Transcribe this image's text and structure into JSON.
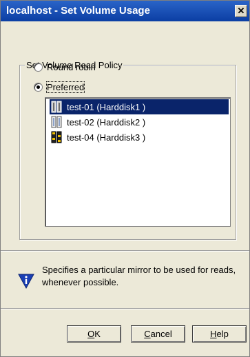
{
  "window": {
    "title": "localhost - Set Volume Usage",
    "close_glyph": "✕"
  },
  "group": {
    "label": "Set Volume Read Policy"
  },
  "radios": [
    {
      "label": "Round robin",
      "checked": false
    },
    {
      "label": "Preferred",
      "checked": true
    }
  ],
  "list": {
    "items": [
      {
        "label": "test-01 (Harddisk1 )",
        "selected": true,
        "icon": "disk-icon"
      },
      {
        "label": "test-02 (Harddisk2 )",
        "selected": false,
        "icon": "disk-icon"
      },
      {
        "label": "test-04 (Harddisk3 )",
        "selected": false,
        "icon": "disk-warning-icon"
      }
    ]
  },
  "info": {
    "text": "Specifies a particular mirror to be used for reads, whenever possible.",
    "icon": "info-shield-icon"
  },
  "buttons": {
    "ok": {
      "label": "OK",
      "accel": "O",
      "rest": "K"
    },
    "cancel": {
      "label": "Cancel",
      "accel": "C",
      "rest": "ancel"
    },
    "help": {
      "label": "Help",
      "accel": "H",
      "rest": "elp"
    }
  },
  "colors": {
    "title_bar": "#0b3ea3",
    "selection": "#0a246a",
    "dialog_bg": "#ece9d8"
  }
}
